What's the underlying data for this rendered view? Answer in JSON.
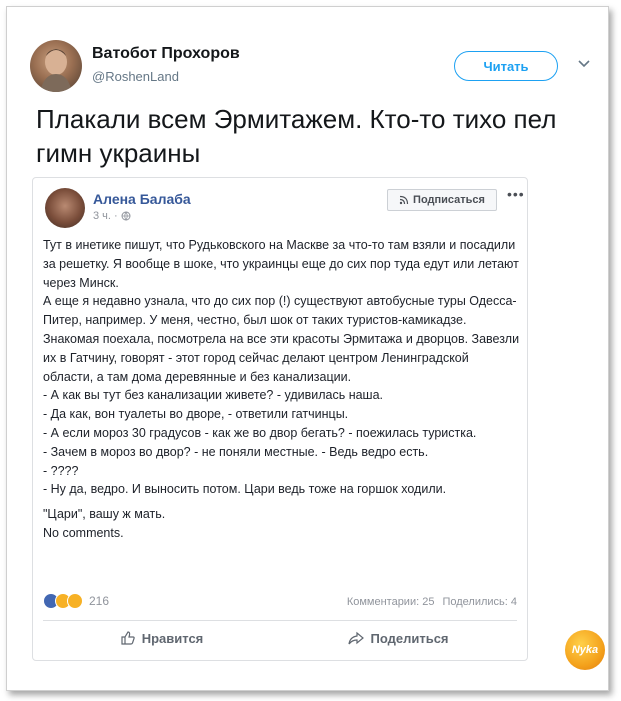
{
  "tweet": {
    "author_name": "Ватобот Прохоров",
    "author_handle": "@RoshenLand",
    "follow_label": "Читать",
    "text": "Плакали всем Эрмитажем. Кто-то тихо пел гимн украины"
  },
  "fb_post": {
    "author_name": "Алена Балаба",
    "time": "3 ч.",
    "subscribe_label": "Подписаться",
    "more_label": "•••",
    "body_lines": [
      "Тут в инетике пишут, что Рудьковского на Маскве за что-то там взяли и посадили за решетку. Я вообще в шоке, что украинцы еще до сих пор туда едут или летают через Минск.",
      "А еще я недавно узнала, что до сих пор (!) существуют автобусные туры Одесса-Питер, например. У меня, честно, был шок от таких туристов-камикадзе. Знакомая поехала, посмотрела на все эти красоты Эрмитажа и дворцов. Завезли их в Гатчину, говорят - этот город сейчас делают центром Ленинградской области, а там дома деревянные и без канализации.",
      "- А как вы тут без канализации живете? - удивилась наша.",
      "- Да как, вон туалеты во дворе, - ответили гатчинцы.",
      "- А если мороз 30 градусов - как же во двор бегать? - поежилась туристка.",
      "- Зачем в мороз во двор? - не поняли местные. - Ведь ведро есть.",
      "- ????",
      "- Ну да, ведро. И выносить потом. Цари ведь тоже на горшок ходили.",
      "\"Цари\", вашу ж мать.",
      "No comments."
    ],
    "reactions_count": "216",
    "comments_label": "Комментарии: 25",
    "shares_label": "Поделились: 4",
    "like_label": "Нравится",
    "share_label": "Поделиться"
  },
  "watermark": "Nyka",
  "colors": {
    "twitter_blue": "#1da1f2",
    "fb_link_blue": "#365899",
    "fb_like_blue": "#4267b2"
  }
}
